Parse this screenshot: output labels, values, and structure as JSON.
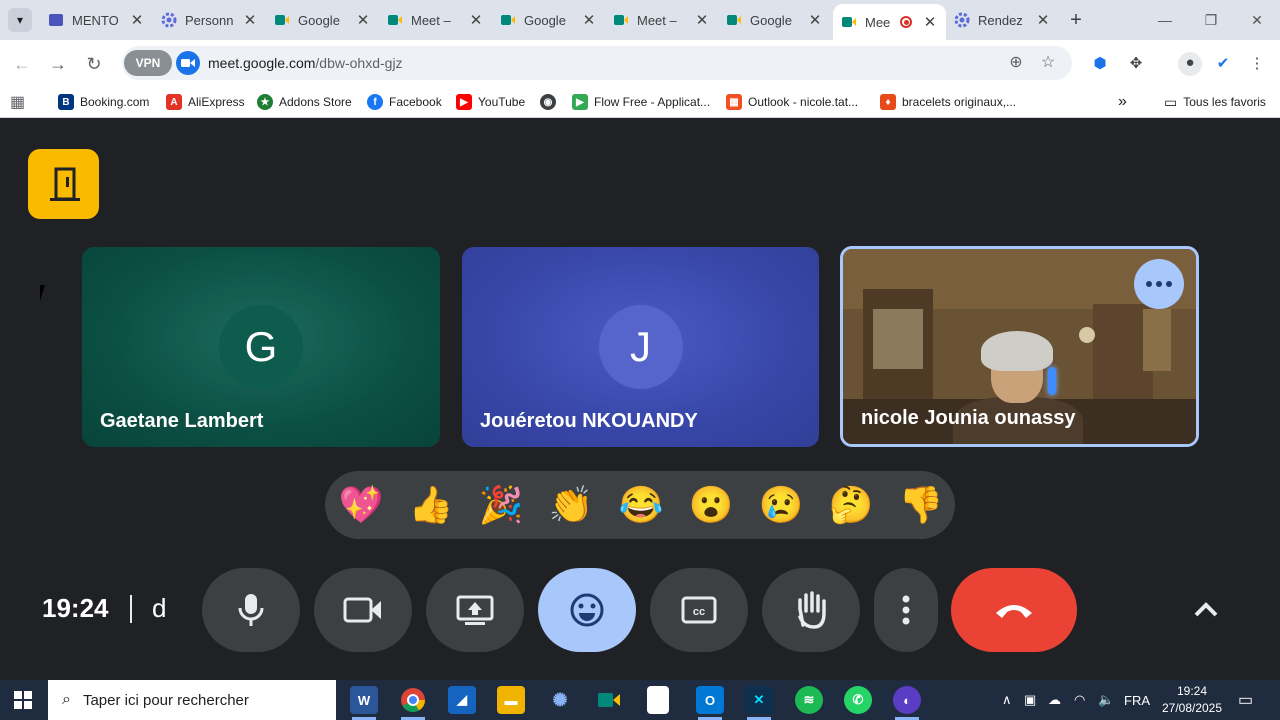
{
  "browser": {
    "tabs": [
      {
        "title": "MENTO",
        "icon": "teams-icon",
        "color": "#4b53bc"
      },
      {
        "title": "Personn",
        "icon": "gear-icon",
        "color": "#5b6bd9"
      },
      {
        "title": "Google",
        "icon": "meet-icon",
        "color": "#00897b"
      },
      {
        "title": "Meet – ",
        "icon": "meet-icon",
        "color": "#00897b"
      },
      {
        "title": "Google",
        "icon": "meet-icon",
        "color": "#00897b"
      },
      {
        "title": "Meet – ",
        "icon": "meet-icon",
        "color": "#00897b"
      },
      {
        "title": "Google",
        "icon": "meet-icon",
        "color": "#00897b"
      },
      {
        "title": "Mee",
        "icon": "meet-icon",
        "color": "#00897b",
        "active": true
      },
      {
        "title": "Rendez",
        "icon": "gear-icon",
        "color": "#5b6bd9"
      }
    ],
    "close_glyph": "✕",
    "new_tab_glyph": "+",
    "vpn_label": "VPN",
    "url_host": "meet.google.com",
    "url_path": "/dbw-ohxd-gjz",
    "bookmarks": [
      {
        "label": "Booking.com",
        "badge": "B",
        "color": "#003580"
      },
      {
        "label": "AliExpress",
        "badge": "A",
        "color": "#e43225"
      },
      {
        "label": "Addons Store",
        "badge": "★",
        "color": "#1e7e34"
      },
      {
        "label": "Facebook",
        "badge": "f",
        "color": "#1877f2"
      },
      {
        "label": "YouTube",
        "badge": "▶",
        "color": "#ff0000"
      },
      {
        "label": "",
        "badge": "◉",
        "color": "#3c4043"
      },
      {
        "label": "Flow Free - Applicat...",
        "badge": "▶",
        "color": "#34a853"
      },
      {
        "label": "Outlook - nicole.tat...",
        "badge": "▦",
        "color": "#f25022"
      },
      {
        "label": "bracelets originaux,...",
        "badge": "♦",
        "color": "#e64a19"
      }
    ],
    "more_bookmarks": "»",
    "all_bookmarks": "Tous les favoris"
  },
  "meet": {
    "participants": [
      {
        "name": "Gaetane Lambert",
        "initial": "G"
      },
      {
        "name": "Jouéretou NKOUANDY",
        "initial": "J"
      },
      {
        "name": "nicole Jounia ounassy",
        "initial": ""
      }
    ],
    "reactions": [
      "💖",
      "👍",
      "🎉",
      "👏",
      "😂",
      "😮",
      "😢",
      "🤔",
      "👎"
    ],
    "clock": "19:24",
    "meeting_code": "d"
  },
  "taskbar": {
    "search_placeholder": "Taper ici pour rechercher",
    "language": "FRA",
    "time": "19:24",
    "date": "27/08/2025"
  },
  "colors": {
    "meet_bg": "#202124",
    "accent": "#a8c7fa",
    "end_call": "#ea4335",
    "companion": "#f9ba00"
  }
}
